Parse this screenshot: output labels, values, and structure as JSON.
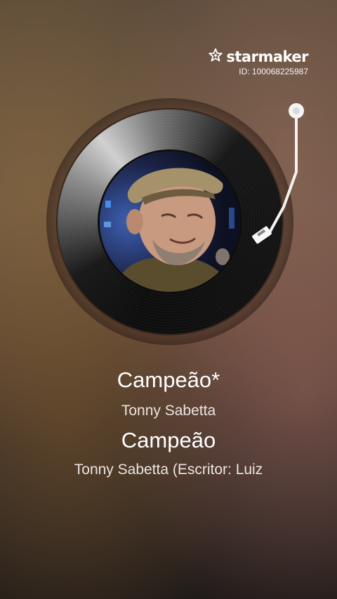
{
  "brand": {
    "name": "starmaker",
    "id_text": "ID: 100068225987"
  },
  "player": {
    "cover_description": "album-art-photo"
  },
  "lyrics": {
    "line1": "Campeão*",
    "line2": "Tonny Sabetta",
    "line3": "Campeão",
    "line4": "Tonny Sabetta (Escritor: Luiz"
  },
  "colors": {
    "record_black": "#0b0b0b",
    "tonearm": "#f2f2f2"
  }
}
